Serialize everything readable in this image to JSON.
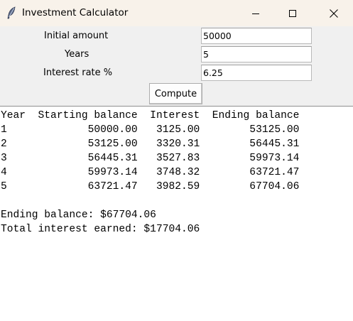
{
  "window": {
    "title": "Investment Calculator"
  },
  "form": {
    "initial_amount_label": "Initial amount",
    "initial_amount_value": "50000",
    "years_label": "Years",
    "years_value": "5",
    "interest_rate_label": "Interest rate %",
    "interest_rate_value": "6.25",
    "compute_label": "Compute"
  },
  "output": {
    "header": "Year  Starting balance  Interest  Ending balance",
    "rows": [
      {
        "year": "1",
        "starting": "50000.00",
        "interest": "3125.00",
        "ending": "53125.00"
      },
      {
        "year": "2",
        "starting": "53125.00",
        "interest": "3320.31",
        "ending": "56445.31"
      },
      {
        "year": "3",
        "starting": "56445.31",
        "interest": "3527.83",
        "ending": "59973.14"
      },
      {
        "year": "4",
        "starting": "59973.14",
        "interest": "3748.32",
        "ending": "63721.47"
      },
      {
        "year": "5",
        "starting": "63721.47",
        "interest": "3982.59",
        "ending": "67704.06"
      }
    ],
    "ending_balance_line": "Ending balance: $67704.06",
    "total_interest_line": "Total interest earned: $17704.06"
  }
}
